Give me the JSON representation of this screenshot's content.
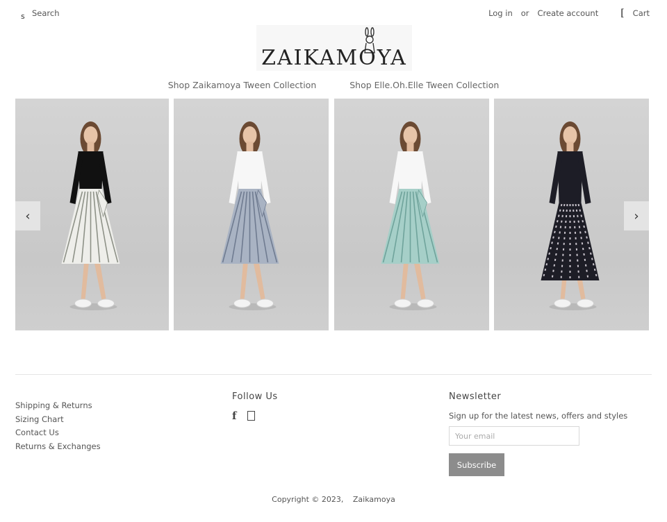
{
  "header": {
    "search_icon": "s",
    "search_placeholder": "Search",
    "login_label": "Log in",
    "or_label": "or",
    "create_account_label": "Create account",
    "cart_icon": "[",
    "cart_label": "Cart"
  },
  "logo": {
    "text": "ZAIKAMOYA"
  },
  "nav": {
    "items": [
      {
        "label": "Shop Zaikamoya Tween Collection"
      },
      {
        "label": "Shop Elle.Oh.Elle Tween Collection"
      }
    ]
  },
  "carousel": {
    "prev_icon": "‹",
    "next_icon": "›",
    "slides": [
      {
        "top_color": "#111111",
        "skirt_color": "#eeeeea",
        "stripe_color": "#8e9288"
      },
      {
        "top_color": "#f7f7f7",
        "skirt_color": "#a9b3c3",
        "stripe_color": "#6f7b90"
      },
      {
        "top_color": "#f7f7f7",
        "skirt_color": "#a6cfc8",
        "stripe_color": "#6fa39b"
      },
      {
        "top_color": "#1d1d26",
        "skirt_color": "#1d1d26",
        "stripe_color": "#c9c4cc"
      }
    ]
  },
  "footer": {
    "links": [
      {
        "label": "Shipping & Returns"
      },
      {
        "label": "Sizing Chart"
      },
      {
        "label": "Contact Us"
      },
      {
        "label": "Returns & Exchanges"
      }
    ],
    "follow_heading": "Follow Us",
    "facebook_icon": "f",
    "newsletter_heading": "Newsletter",
    "newsletter_text": "Sign up for the latest news, offers and styles",
    "email_placeholder": "Your email",
    "subscribe_label": "Subscribe",
    "copyright": "Copyright © 2023,",
    "brand": "Zaikamoya"
  }
}
